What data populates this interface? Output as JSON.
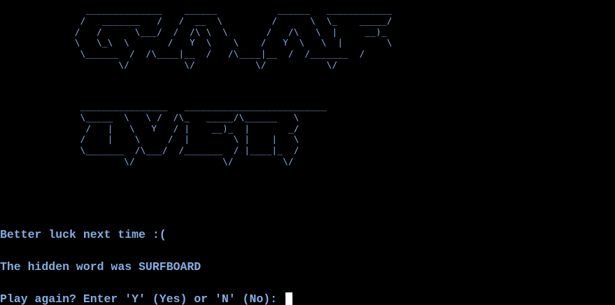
{
  "game_over_art": {
    "word_game": "   ______________    ______           ______   ____________\n  /   _______   /   /  __  \\         /      \\  \\_    _____/\n /   /      \\___/  /  /\\ \\  \\       /   /\\   \\  |     __)_\n \\   \\_\\  \\       /   Y  \\    \\    /   Y  \\   \\  |        \\\n  \\______  /  /\\____|__  /   /\\____|__  /  /_______  /\n         \\/          \\/           \\/           \\/",
    "word_over": "  ________________   __________________________\n  \\_____  \\   \\ /  /\\_   _____/\\______   \\\n   /   |   \\   Y   / |    __)_  |       _/\n  /    |    \\     /  |        \\ |    |   \\\n  \\_______  /\\___/  /_______  / |____|_  /\n          \\/                \\/         \\/"
  },
  "messages": {
    "lose": "Better luck next time :(",
    "reveal": "The hidden word was SURFBOARD",
    "prompt": "Play again? Enter 'Y' (Yes) or 'N' (No): "
  },
  "colors": {
    "text": "#84aee3",
    "background": "#000000",
    "cursor": "#ffffff"
  }
}
